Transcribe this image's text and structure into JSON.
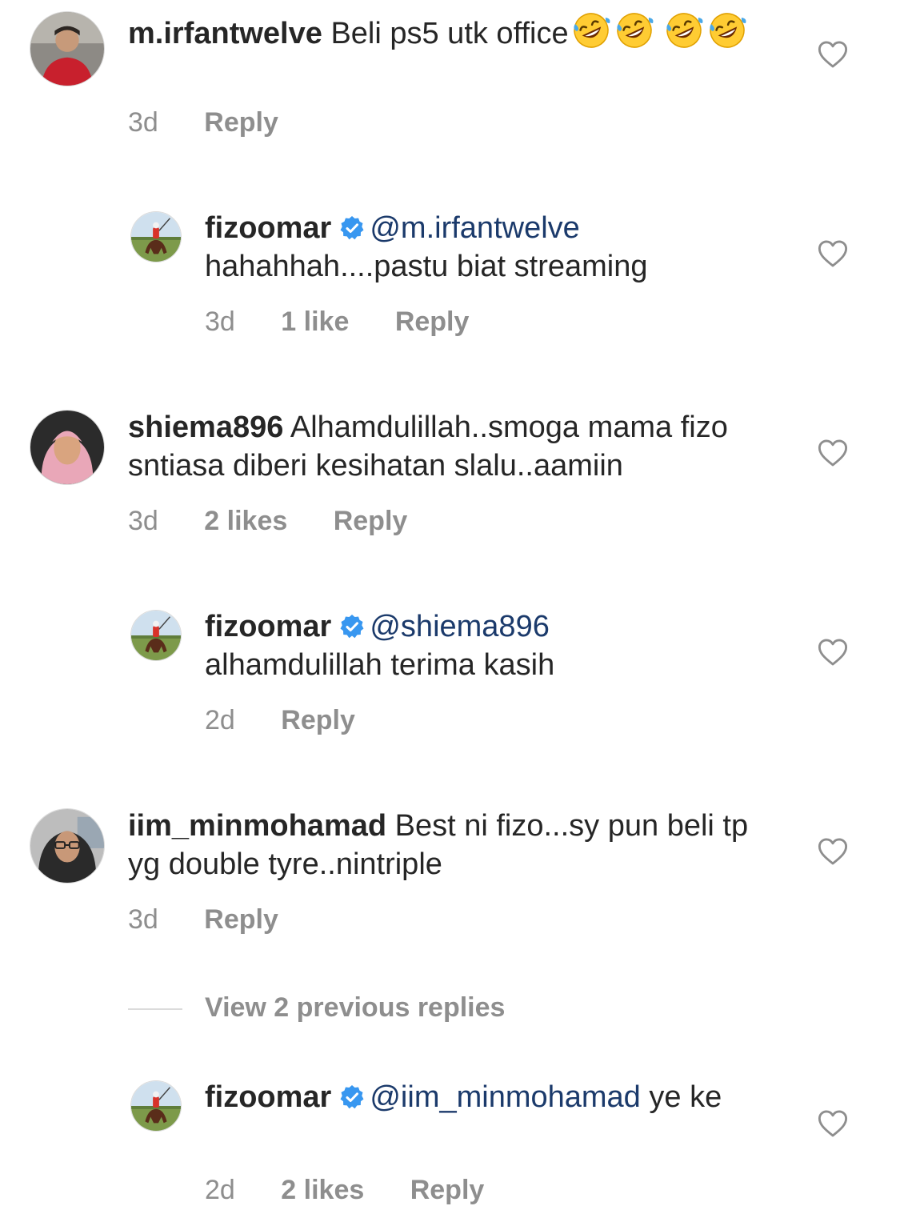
{
  "comments": [
    {
      "username": "m.irfantwelve",
      "text": "Beli ps5 utk office",
      "time": "3d",
      "likes": "",
      "reply": "Reply"
    },
    {
      "username": "fizoomar",
      "mention": "@m.irfantwelve",
      "text": "hahahhah....pastu biat streaming",
      "time": "3d",
      "likes": "1 like",
      "reply": "Reply"
    },
    {
      "username": "shiema896",
      "text": "Alhamdulillah..smoga mama fizo sntiasa diberi kesihatan slalu..aamiin",
      "time": "3d",
      "likes": "2 likes",
      "reply": "Reply"
    },
    {
      "username": "fizoomar",
      "mention": "@shiema896",
      "text": "alhamdulillah terima kasih",
      "time": "2d",
      "likes": "",
      "reply": "Reply"
    },
    {
      "username": "iim_minmohamad",
      "text": "Best ni fizo...sy pun beli tp yg double tyre..nintriple",
      "time": "3d",
      "likes": "",
      "reply": "Reply"
    },
    {
      "username": "fizoomar",
      "mention": "@iim_minmohamad",
      "text": "ye ke",
      "time": "2d",
      "likes": "2 likes",
      "reply": "Reply"
    }
  ],
  "view_previous_replies": "View 2 previous replies",
  "icons": {
    "like": "heart-outline-icon",
    "verified": "verified-badge-icon",
    "emoji": "rolling-laughing-emoji"
  },
  "colors": {
    "text": "#262626",
    "meta": "#8e8e8e",
    "mention": "#1b3a6b",
    "verified": "#3897f0"
  }
}
